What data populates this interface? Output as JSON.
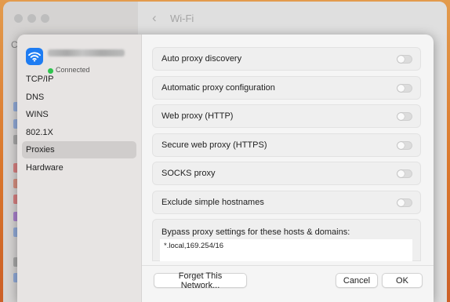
{
  "background_window": {
    "title": "Wi-Fi",
    "sidebar_letter": "C"
  },
  "network": {
    "status": "Connected",
    "status_color": "#2ec44e",
    "icon": "wifi-icon"
  },
  "sidebar": {
    "items": [
      {
        "label": "TCP/IP",
        "selected": false
      },
      {
        "label": "DNS",
        "selected": false
      },
      {
        "label": "WINS",
        "selected": false
      },
      {
        "label": "802.1X",
        "selected": false
      },
      {
        "label": "Proxies",
        "selected": true
      },
      {
        "label": "Hardware",
        "selected": false
      }
    ]
  },
  "proxies": {
    "rows": [
      {
        "label": "Auto proxy discovery",
        "enabled": false
      },
      {
        "label": "Automatic proxy configuration",
        "enabled": false
      },
      {
        "label": "Web proxy (HTTP)",
        "enabled": false
      },
      {
        "label": "Secure web proxy (HTTPS)",
        "enabled": false
      },
      {
        "label": "SOCKS proxy",
        "enabled": false
      },
      {
        "label": "Exclude simple hostnames",
        "enabled": false
      }
    ],
    "bypass_label": "Bypass proxy settings for these hosts & domains:",
    "bypass_value": "*.local,169.254/16"
  },
  "footer": {
    "forget_label": "Forget This Network...",
    "cancel_label": "Cancel",
    "ok_label": "OK"
  },
  "colors": {
    "accent": "#1e7cf2",
    "wallpaper": "#e87f2f"
  }
}
